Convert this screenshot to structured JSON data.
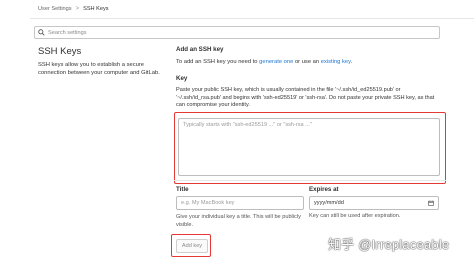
{
  "breadcrumb": {
    "items": [
      "User Settings",
      "SSH Keys"
    ],
    "separator": ">"
  },
  "search": {
    "placeholder": "Search settings"
  },
  "left": {
    "title": "SSH Keys",
    "description": "SSH keys allow you to establish a secure connection between your computer and GitLab."
  },
  "form": {
    "section_title": "Add an SSH key",
    "section_desc_prefix": "To add an SSH key you need to ",
    "generate_link": "generate one",
    "section_desc_mid": " or use an ",
    "existing_link": "existing key",
    "section_desc_suffix": ".",
    "key_label": "Key",
    "key_help": "Paste your public SSH key, which is usually contained in the file '~/.ssh/id_ed25519.pub' or '~/.ssh/id_rsa.pub' and begins with 'ssh-ed25519' or 'ssh-rsa'. Do not paste your private SSH key, as that can compromise your identity.",
    "key_placeholder": "Typically starts with \"ssh-ed25519 ...\" or \"ssh-rsa ...\"",
    "title_label": "Title",
    "title_placeholder": "e.g. My MacBook key",
    "title_help": "Give your individual key a title. This will be publicly visible.",
    "expires_label": "Expires at",
    "expires_value": "yyyy/mm/dd",
    "expires_help": "Key can still be used after expiration.",
    "add_button": "Add key"
  },
  "watermark": "知乎 @Irreplaceable",
  "colors": {
    "link": "#1f78d1",
    "highlight": "#e53935"
  }
}
